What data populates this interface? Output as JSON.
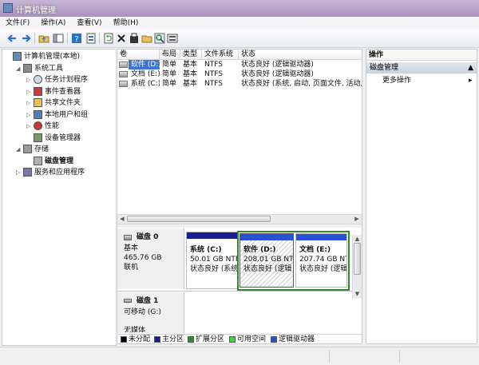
{
  "window": {
    "title": "计算机管理"
  },
  "menu": [
    "文件(F)",
    "操作(A)",
    "查看(V)",
    "帮助(H)"
  ],
  "tree": [
    {
      "label": "计算机管理(本地)",
      "depth": 0,
      "icon": "computer-icon",
      "expander": "",
      "selected": false
    },
    {
      "label": "系统工具",
      "depth": 1,
      "icon": "tools-icon",
      "expander": "◢",
      "selected": false
    },
    {
      "label": "任务计划程序",
      "depth": 2,
      "icon": "clock-icon",
      "expander": "▷",
      "selected": false
    },
    {
      "label": "事件查看器",
      "depth": 2,
      "icon": "event-viewer-icon",
      "expander": "▷",
      "selected": false
    },
    {
      "label": "共享文件夹",
      "depth": 2,
      "icon": "shared-folder-icon",
      "expander": "▷",
      "selected": false
    },
    {
      "label": "本地用户和组",
      "depth": 2,
      "icon": "users-icon",
      "expander": "▷",
      "selected": false
    },
    {
      "label": "性能",
      "depth": 2,
      "icon": "performance-icon",
      "expander": "▷",
      "selected": false
    },
    {
      "label": "设备管理器",
      "depth": 2,
      "icon": "device-manager-icon",
      "expander": "",
      "selected": false
    },
    {
      "label": "存储",
      "depth": 1,
      "icon": "storage-icon",
      "expander": "◢",
      "selected": false
    },
    {
      "label": "磁盘管理",
      "depth": 2,
      "icon": "disk-management-icon",
      "expander": "",
      "selected": true
    },
    {
      "label": "服务和应用程序",
      "depth": 1,
      "icon": "services-icon",
      "expander": "▷",
      "selected": false
    }
  ],
  "volumes": {
    "columns": [
      "卷",
      "布局",
      "类型",
      "文件系统",
      "状态"
    ],
    "rows": [
      [
        "软件 (D:)",
        "简单",
        "基本",
        "NTFS",
        "状态良好 (逻辑驱动器)"
      ],
      [
        "文档 (E:)",
        "简单",
        "基本",
        "NTFS",
        "状态良好 (逻辑驱动器)"
      ],
      [
        "系统 (C:)",
        "简单",
        "基本",
        "NTFS",
        "状态良好 (系统, 启动, 页面文件, 活动, 故"
      ]
    ]
  },
  "disks": [
    {
      "name": "磁盘 0",
      "type": "基本",
      "size": "465.76 GB",
      "status": "联机"
    },
    {
      "name": "磁盘 1",
      "type": "可移动 (G:)",
      "size": "",
      "status": ""
    }
  ],
  "disk2_partial": "无媒体",
  "partitions": [
    {
      "name": "系统 (C:)",
      "size": "50.01 GB NTFS",
      "status": "状态良好 (系统"
    },
    {
      "name": "软件 (D:)",
      "size": "208.01 GB NTFS",
      "status": "状态良好 (逻辑"
    },
    {
      "name": "文档 (E:)",
      "size": "207.74 GB NTFS",
      "status": "状态良好 (逻辑"
    }
  ],
  "legend": [
    {
      "label": "未分配",
      "color": "#000000"
    },
    {
      "label": "主分区",
      "color": "#1c1c8f"
    },
    {
      "label": "扩展分区",
      "color": "#2e8b2e"
    },
    {
      "label": "可用空间",
      "color": "#3cd43c"
    },
    {
      "label": "逻辑驱动器",
      "color": "#2b4fd8"
    }
  ],
  "actions": {
    "header": "操作",
    "section": "磁盘管理",
    "item": "更多操作"
  }
}
